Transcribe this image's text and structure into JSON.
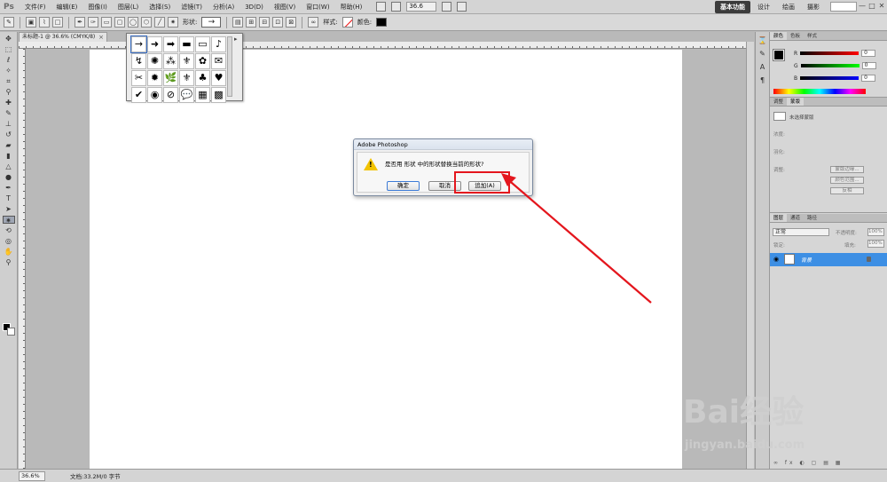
{
  "app": {
    "logo": "Ps",
    "menus": [
      "文件(F)",
      "编辑(E)",
      "图像(I)",
      "图层(L)",
      "选择(S)",
      "滤镜(T)",
      "分析(A)",
      "3D(D)",
      "视图(V)",
      "窗口(W)",
      "帮助(H)"
    ],
    "zoom": "36.6",
    "workspaces": [
      "基本功能",
      "设计",
      "绘画",
      "摄影"
    ],
    "window_controls": [
      "—",
      "□",
      "✕"
    ]
  },
  "options": {
    "shape_label": "形状:",
    "style_label": "样式:",
    "color_label": "颜色:",
    "shape_glyph": "→",
    "color": "#000000"
  },
  "document": {
    "tab_title": "未标题-1 @ 36.6% (CMYK/8)",
    "close": "×"
  },
  "shape_picker": {
    "shapes": [
      "→",
      "➜",
      "➡",
      "▬",
      "▭",
      "♪",
      "↯",
      "✺",
      "⁂",
      "⚜",
      "✿",
      "✉",
      "✂",
      "✹",
      "🌿",
      "⚜",
      "♣",
      "♥",
      "✔",
      "◉",
      "⊘",
      "💬",
      "▦",
      "▩"
    ],
    "gear": "▸"
  },
  "dialog": {
    "title": "Adobe Photoshop",
    "message": "是否用 形状 中的形状替换当前的形状?",
    "ok": "确定",
    "cancel": "取消",
    "append": "追加(A)"
  },
  "panels": {
    "color_tabs": [
      "颜色",
      "色板",
      "样式"
    ],
    "color": {
      "r_label": "R",
      "g_label": "G",
      "b_label": "B",
      "r": "0",
      "g": "0",
      "b": "0"
    },
    "adj_tabs": [
      "调整",
      "蒙版"
    ],
    "adjust": {
      "title": "未选择蒙版",
      "density": "浓度:",
      "feather": "羽化:",
      "refine": "调整:",
      "btn_edge": "蒙版边缘...",
      "btn_color": "颜色范围...",
      "btn_invert": "反相"
    },
    "layer_tabs": [
      "图层",
      "通道",
      "路径"
    ],
    "layers": {
      "blend": "正常",
      "opacity_label": "不透明度:",
      "opacity": "100%",
      "lock_label": "锁定:",
      "fill_label": "填充:",
      "fill": "100%",
      "layer_name": "背景",
      "bottom_icons": "∞ fx ◐ ▢ ▤ ▦"
    }
  },
  "status": {
    "zoom": "36.6%",
    "doc_info": "文档:33.2M/0 字节"
  },
  "watermark": {
    "text": "Bai经验",
    "sub": "jingyan.baidu.com"
  },
  "annotation": {
    "highlight_color": "#e4161d"
  }
}
